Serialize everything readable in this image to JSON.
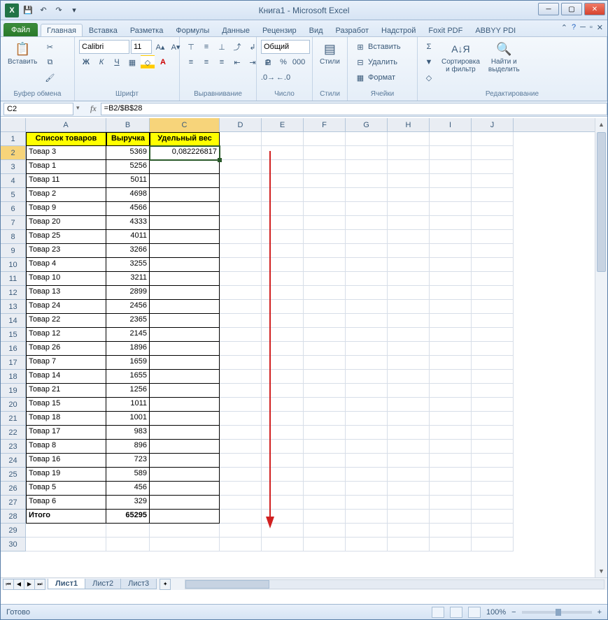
{
  "title": "Книга1  -  Microsoft Excel",
  "tabs": {
    "file": "Файл",
    "home": "Главная",
    "insert": "Вставка",
    "layout": "Разметка",
    "formulas": "Формулы",
    "data": "Данные",
    "review": "Рецензир",
    "view": "Вид",
    "developer": "Разработ",
    "addins": "Надстрой",
    "foxit": "Foxit PDF",
    "abbyy": "ABBYY PDI"
  },
  "groups": {
    "clipboard": "Буфер обмена",
    "font": "Шрифт",
    "alignment": "Выравнивание",
    "number": "Число",
    "styles": "Стили",
    "cells": "Ячейки",
    "editing": "Редактирование"
  },
  "ribbon": {
    "paste": "Вставить",
    "font_name": "Calibri",
    "font_size": "11",
    "number_format": "Общий",
    "styles_btn": "Стили",
    "insert_btn": "Вставить",
    "delete_btn": "Удалить",
    "format_btn": "Формат",
    "sort_btn": "Сортировка\nи фильтр",
    "find_btn": "Найти и\nвыделить"
  },
  "namebox": "C2",
  "formula": "=B2/$B$28",
  "colwidths": {
    "A": 115,
    "B": 62,
    "C": 100,
    "D": 60,
    "E": 60,
    "F": 60,
    "G": 60,
    "H": 60,
    "I": 60,
    "J": 60
  },
  "visible_cols": [
    "A",
    "B",
    "C",
    "D",
    "E",
    "F",
    "G",
    "H",
    "I",
    "J"
  ],
  "visible_rows": 30,
  "active_cell": "C2",
  "headers": {
    "A1": "Список товаров",
    "B1": "Выручка",
    "C1": "Удельный вес"
  },
  "data_rows": [
    {
      "name": "Товар 3",
      "rev": 5369,
      "weight": "0,082226817"
    },
    {
      "name": "Товар 1",
      "rev": 5256
    },
    {
      "name": "Товар 11",
      "rev": 5011
    },
    {
      "name": "Товар 2",
      "rev": 4698
    },
    {
      "name": "Товар 9",
      "rev": 4566
    },
    {
      "name": "Товар 20",
      "rev": 4333
    },
    {
      "name": "Товар 25",
      "rev": 4011
    },
    {
      "name": "Товар 23",
      "rev": 3266
    },
    {
      "name": "Товар 4",
      "rev": 3255
    },
    {
      "name": "Товар 10",
      "rev": 3211
    },
    {
      "name": "Товар 13",
      "rev": 2899
    },
    {
      "name": "Товар 24",
      "rev": 2456
    },
    {
      "name": "Товар 22",
      "rev": 2365
    },
    {
      "name": "Товар 12",
      "rev": 2145
    },
    {
      "name": "Товар 26",
      "rev": 1896
    },
    {
      "name": "Товар 7",
      "rev": 1659
    },
    {
      "name": "Товар 14",
      "rev": 1655
    },
    {
      "name": "Товар 21",
      "rev": 1256
    },
    {
      "name": "Товар 15",
      "rev": 1011
    },
    {
      "name": "Товар 18",
      "rev": 1001
    },
    {
      "name": "Товар 17",
      "rev": 983
    },
    {
      "name": "Товар 8",
      "rev": 896
    },
    {
      "name": "Товар 16",
      "rev": 723
    },
    {
      "name": "Товар 19",
      "rev": 589
    },
    {
      "name": "Товар 5",
      "rev": 456
    },
    {
      "name": "Товар 6",
      "rev": 329
    }
  ],
  "total_row": {
    "label": "Итого",
    "value": 65295
  },
  "sheets": [
    "Лист1",
    "Лист2",
    "Лист3"
  ],
  "status": "Готово",
  "zoom": "100%"
}
